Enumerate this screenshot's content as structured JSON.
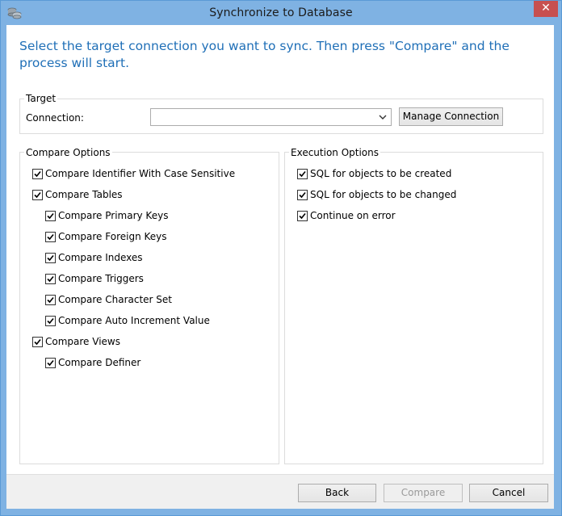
{
  "window": {
    "title": "Synchronize to Database",
    "close_glyph": "✕",
    "app_icon": "database-sync-icon"
  },
  "instruction": "Select the target connection you want to sync. Then press \"Compare\" and the process will start.",
  "target": {
    "group_label": "Target",
    "connection_label": "Connection:",
    "connection_value": "",
    "manage_button": "Manage Connection"
  },
  "compare_options": {
    "group_label": "Compare Options",
    "items": [
      {
        "label": "Compare Identifier With Case Sensitive",
        "checked": true
      },
      {
        "label": "Compare Tables",
        "checked": true
      },
      {
        "label": "Compare Primary Keys",
        "checked": true
      },
      {
        "label": "Compare Foreign Keys",
        "checked": true
      },
      {
        "label": "Compare Indexes",
        "checked": true
      },
      {
        "label": "Compare Triggers",
        "checked": true
      },
      {
        "label": "Compare Character Set",
        "checked": true
      },
      {
        "label": "Compare Auto Increment Value",
        "checked": true
      },
      {
        "label": "Compare Views",
        "checked": true
      },
      {
        "label": "Compare Definer",
        "checked": true
      }
    ]
  },
  "execution_options": {
    "group_label": "Execution Options",
    "items": [
      {
        "label": "SQL for objects to be created",
        "checked": true
      },
      {
        "label": "SQL for objects to be changed",
        "checked": true
      },
      {
        "label": "Continue on error",
        "checked": true
      }
    ]
  },
  "buttons": {
    "back": "Back",
    "compare": "Compare",
    "cancel": "Cancel"
  }
}
